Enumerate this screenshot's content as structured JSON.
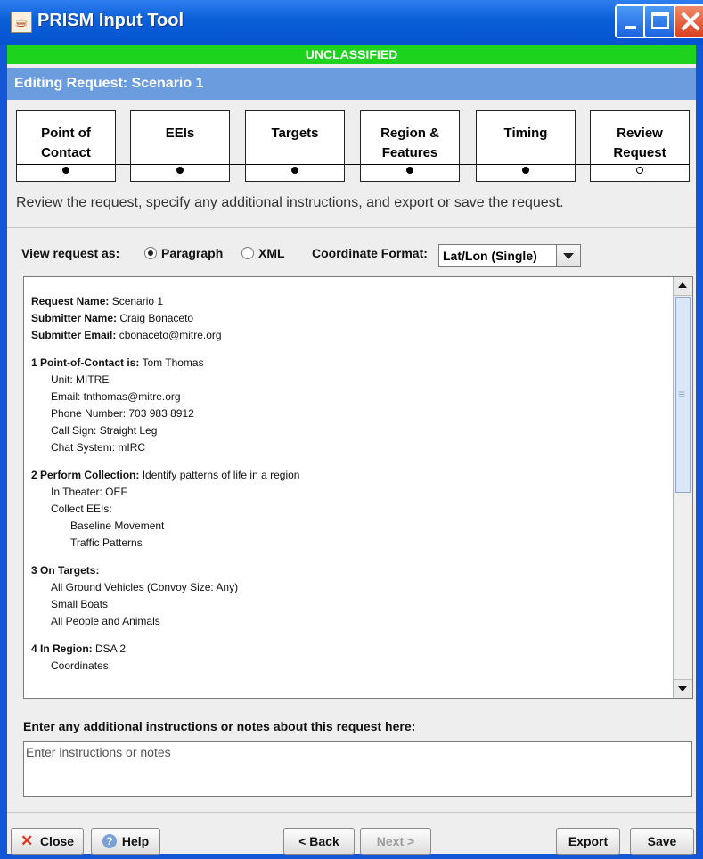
{
  "window": {
    "title": "PRISM Input Tool"
  },
  "classification": "UNCLASSIFIED",
  "editing_title": "Editing Request: Scenario 1",
  "steps": [
    {
      "line1": "Point of",
      "line2": "Contact"
    },
    {
      "line1": "EEIs",
      "line2": ""
    },
    {
      "line1": "Targets",
      "line2": ""
    },
    {
      "line1": "Region &",
      "line2": "Features"
    },
    {
      "line1": "Timing",
      "line2": ""
    },
    {
      "line1": "Review",
      "line2": "Request"
    }
  ],
  "instructions": "Review the request, specify any additional instructions, and export or save the request.",
  "view": {
    "label": "View request as:",
    "option_paragraph": "Paragraph",
    "option_xml": "XML",
    "selected": "Paragraph",
    "coord_label": "Coordinate Format:",
    "coord_value": "Lat/Lon (Single)"
  },
  "request": {
    "name_label": "Request Name:",
    "name": "Scenario 1",
    "submitter_label": "Submitter Name:",
    "submitter": "Craig Bonaceto",
    "email_label": "Submitter Email:",
    "email": "cbonaceto@mitre.org",
    "poc_heading": "1 Point-of-Contact is:",
    "poc_name": "Tom Thomas",
    "poc_unit": "Unit:  MITRE",
    "poc_email": "Email:  tnthomas@mitre.org",
    "poc_phone": "Phone Number:  703 983 8912",
    "poc_callsign": "Call Sign:  Straight Leg",
    "poc_chat": "Chat System:  mIRC",
    "collect_heading": "2 Perform Collection:",
    "collect_text": "Identify patterns of life in a region",
    "collect_theater": "In Theater: OEF",
    "collect_eeis": "Collect EEIs:",
    "eei_1": "Baseline Movement",
    "eei_2": "Traffic Patterns",
    "targets_heading": "3 On Targets:",
    "target_1": "All Ground Vehicles (Convoy Size: Any)",
    "target_2": "Small Boats",
    "target_3": "All People and Animals",
    "region_heading": "4 In Region:",
    "region_name": "DSA 2",
    "region_coords": "Coordinates:"
  },
  "notes": {
    "label": "Enter any additional instructions or notes about this request here:",
    "placeholder": "Enter instructions or notes"
  },
  "buttons": {
    "close": "Close",
    "help": "Help",
    "back": "< Back",
    "next": "Next >",
    "export": "Export",
    "save": "Save"
  }
}
